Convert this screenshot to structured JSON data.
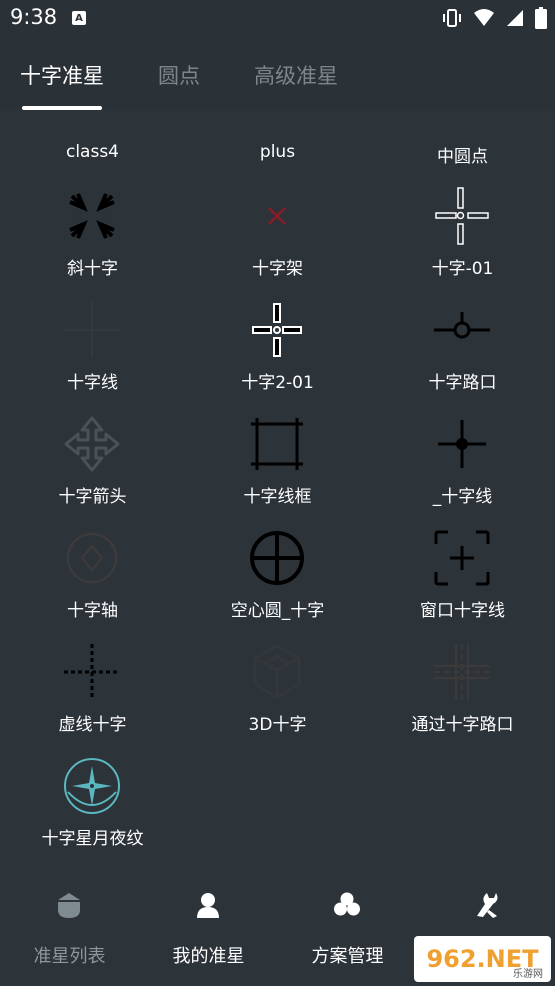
{
  "status_bar": {
    "time": "9:38",
    "app_icon_letter": "A"
  },
  "tabs": [
    {
      "label": "十字准星",
      "active": true
    },
    {
      "label": "圆点",
      "active": false
    },
    {
      "label": "高级准星",
      "active": false
    }
  ],
  "crosshairs": [
    {
      "label": "class4",
      "icon": "class4-icon"
    },
    {
      "label": "plus",
      "icon": "plus-icon"
    },
    {
      "label": "中圆点",
      "icon": "medium-dot-icon"
    },
    {
      "label": "斜十字",
      "icon": "diagonal-cross-icon"
    },
    {
      "label": "十字架",
      "icon": "small-x-icon"
    },
    {
      "label": "十字-01",
      "icon": "cross-01-icon"
    },
    {
      "label": "十字线",
      "icon": "thin-crosshair-icon"
    },
    {
      "label": "十字2-01",
      "icon": "cross-2-01-icon"
    },
    {
      "label": "十字路口",
      "icon": "crossroad-icon"
    },
    {
      "label": "十字箭头",
      "icon": "cross-arrow-icon"
    },
    {
      "label": "十字线框",
      "icon": "crosshair-frame-icon"
    },
    {
      "label": "_十字线",
      "icon": "dot-crosshair-icon"
    },
    {
      "label": "十字轴",
      "icon": "cross-axis-icon"
    },
    {
      "label": "空心圆_十字",
      "icon": "hollow-circle-cross-icon"
    },
    {
      "label": "窗口十字线",
      "icon": "window-crosshair-icon"
    },
    {
      "label": "虚线十字",
      "icon": "dashed-cross-icon"
    },
    {
      "label": "3D十字",
      "icon": "3d-cube-icon"
    },
    {
      "label": "通过十字路口",
      "icon": "pass-crossroad-icon"
    },
    {
      "label": "十字星月夜纹",
      "icon": "star-moon-icon"
    }
  ],
  "bottom_nav": [
    {
      "label": "准星列表",
      "icon": "crosshair-list-icon",
      "active": true
    },
    {
      "label": "我的准星",
      "icon": "user-icon",
      "active": false
    },
    {
      "label": "方案管理",
      "icon": "club-icon",
      "active": false
    },
    {
      "label": "",
      "icon": "wrench-icon",
      "active": false
    }
  ],
  "watermark": {
    "text": "962.NET",
    "sub": "乐游网"
  },
  "colors": {
    "background": "#2c3339",
    "text": "#ffffff",
    "muted": "#7f868b",
    "red_x": "#8b1a2a",
    "teal": "#5bb8c0"
  }
}
